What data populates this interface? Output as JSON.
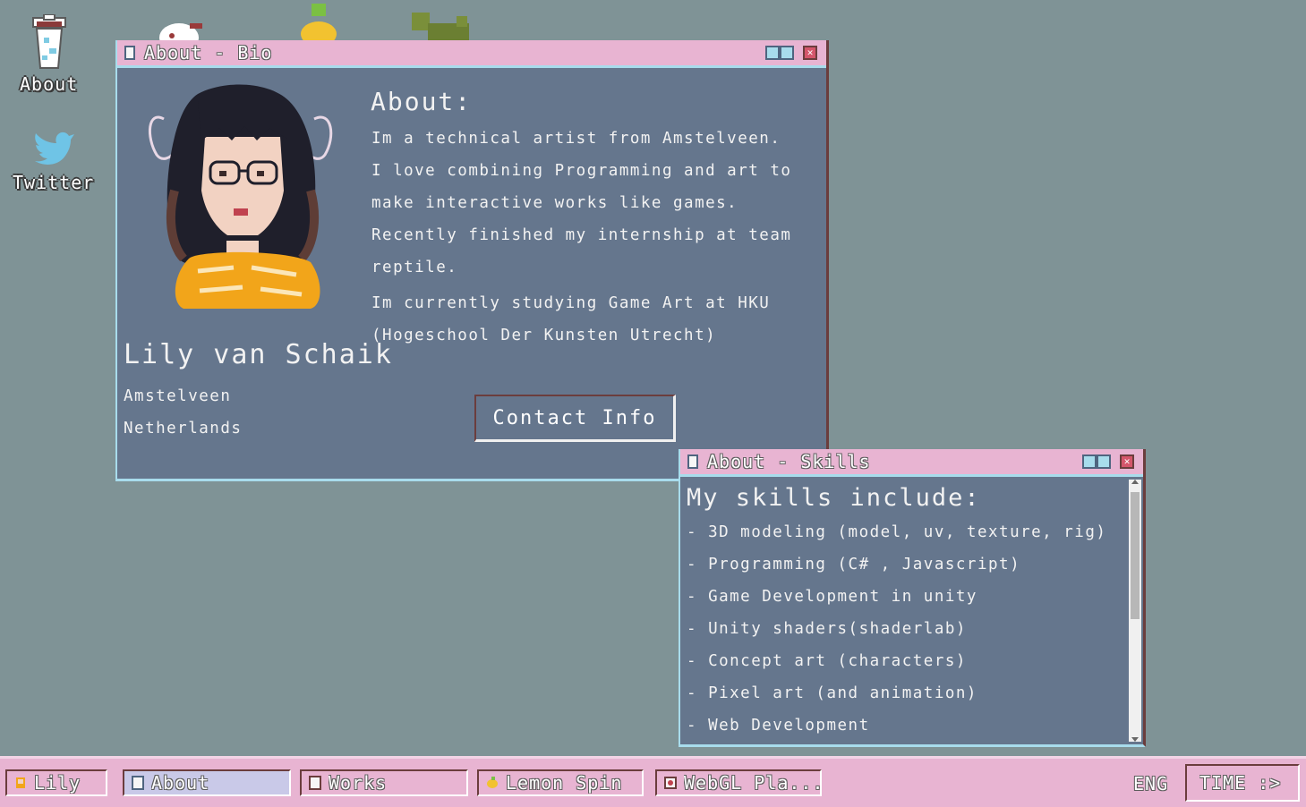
{
  "desktop": {
    "icons": [
      {
        "label": "About",
        "icon": "trash-bin-icon"
      },
      {
        "label": "Twitter",
        "icon": "twitter-bird-icon"
      }
    ]
  },
  "bio_window": {
    "title": "About - Bio",
    "heading": "About:",
    "paragraph1": [
      "Im a technical artist from Amstelveen.",
      "I love combining Programming and art to",
      "make interactive works like games.",
      "Recently finished my internship at team",
      "reptile."
    ],
    "paragraph2": [
      "Im currently studying Game Art at HKU",
      "(Hogeschool Der Kunsten Utrecht)"
    ],
    "name": "Lily van Schaik",
    "city": "Amstelveen",
    "country": "Netherlands",
    "contact_button": "Contact Info"
  },
  "skills_window": {
    "title": "About - Skills",
    "heading": "My skills include:",
    "items": [
      "- 3D modeling (model, uv, texture, rig)",
      "- Programming (C# , Javascript)",
      "- Game Development in unity",
      "- Unity shaders(shaderlab)",
      "- Concept art (characters)",
      "- Pixel art (and animation)",
      "- Web Development"
    ]
  },
  "taskbar": {
    "start_label": "Lily",
    "tabs": [
      {
        "label": "About",
        "icon": "window-icon",
        "active": true
      },
      {
        "label": "Works",
        "icon": "window-icon",
        "active": false
      },
      {
        "label": "Lemon Spin",
        "icon": "lemon-icon",
        "active": false
      },
      {
        "label": "WebGL Pla...",
        "icon": "webgl-icon",
        "active": false
      }
    ],
    "lang": "ENG",
    "clock": "TIME :>"
  },
  "colors": {
    "desktop_bg": "#7f9396",
    "window_bg": "#65768d",
    "titlebar_pink": "#e8b4d2",
    "accent_blue": "#a8dcec",
    "border_brown": "#6b3d3d"
  }
}
